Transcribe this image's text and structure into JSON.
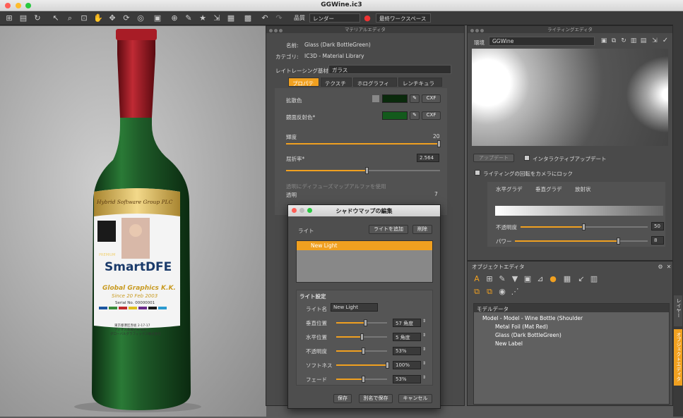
{
  "app": {
    "title": "GGWine.ic3"
  },
  "toolbar": {
    "quality_label": "品質",
    "quality_value": "レンダー",
    "workspace_value": "最終ワークスペース"
  },
  "material_editor": {
    "title": "マテリアルエディタ",
    "name_label": "名前:",
    "name_value": "Glass (Dark BottleGreen)",
    "category_label": "カテゴリ:",
    "category_value": "IC3D - Material Library",
    "raytrace_label": "レイトレーシング基材",
    "raytrace_value": "ガラス",
    "tabs": [
      "プロパティ",
      "テクスチャ",
      "ホログラフィック",
      "レンチキュラー"
    ],
    "diffuse_label": "拡散色",
    "specular_label": "鏡面反射色*",
    "cxf": "CXF",
    "brightness_label": "輝度",
    "brightness_value": "20",
    "ior_label": "屈折率*",
    "ior_value": "2.564",
    "alpha_check_label": "透明にディフューズマップアルファを使用",
    "transparency_label": "透明",
    "transparency_value": "7"
  },
  "lighting_editor": {
    "title": "ライティングエディタ",
    "env_label": "環境",
    "env_value": "GGWine",
    "update_btn": "アップデート",
    "interactive_update": "インタラクティブアップデート",
    "lock_rotation": "ライティングの回転をカメラにロック",
    "gradients": [
      "水平グラデ",
      "垂直グラデ",
      "放射状"
    ],
    "opacity_label": "不透明度",
    "opacity_value": "50",
    "power_label": "パワー",
    "power_value": "8"
  },
  "shadow_dialog": {
    "title": "シャドウマップの編集",
    "light_label": "ライト",
    "add_light": "ライトを追加",
    "delete": "削除",
    "lights": [
      "New Light"
    ],
    "settings_label": "ライト設定",
    "light_name_label": "ライト名",
    "light_name_value": "New Light",
    "params": [
      {
        "label": "垂直位置",
        "value": "57 角度",
        "fraction": 0.57
      },
      {
        "label": "水平位置",
        "value": "5 角度",
        "fraction": 0.5
      },
      {
        "label": "不透明度",
        "value": "53%",
        "fraction": 0.53
      },
      {
        "label": "ソフトネス",
        "value": "100%",
        "fraction": 1.0
      },
      {
        "label": "フェード",
        "value": "53%",
        "fraction": 0.53
      }
    ],
    "save": "保存",
    "save_as": "別名で保存",
    "cancel": "キャンセル"
  },
  "object_editor": {
    "title": "オブジェクトエディタ",
    "model_data_label": "モデルデータ",
    "tree": [
      "Model - Model - Wine Bottle (Shoulder",
      "Metal Foil (Mat Red)",
      "Glass (Dark BottleGreen)",
      "New Label"
    ]
  },
  "sidebar": {
    "tabs": [
      "レイヤー",
      "オブジェクトエディタ"
    ]
  },
  "label": {
    "company": "Hybrid Software Group PLC",
    "brand": "SmartDFE",
    "gg": "Global Graphics K.K.",
    "since": "Since 20 Feb 2003",
    "serial": "Serial No. 00000001",
    "addr1": "東京都港区赤坂 2-17-17",
    "addr2": "ティオス赤坂ビル 6/3",
    "addr3": "グローバルグラフィックス株式会社",
    "badge": "PREMIUM"
  },
  "colors": {
    "accent": "#f0a020",
    "bottle": "#1f5a28",
    "foil": "#9a1a22"
  }
}
